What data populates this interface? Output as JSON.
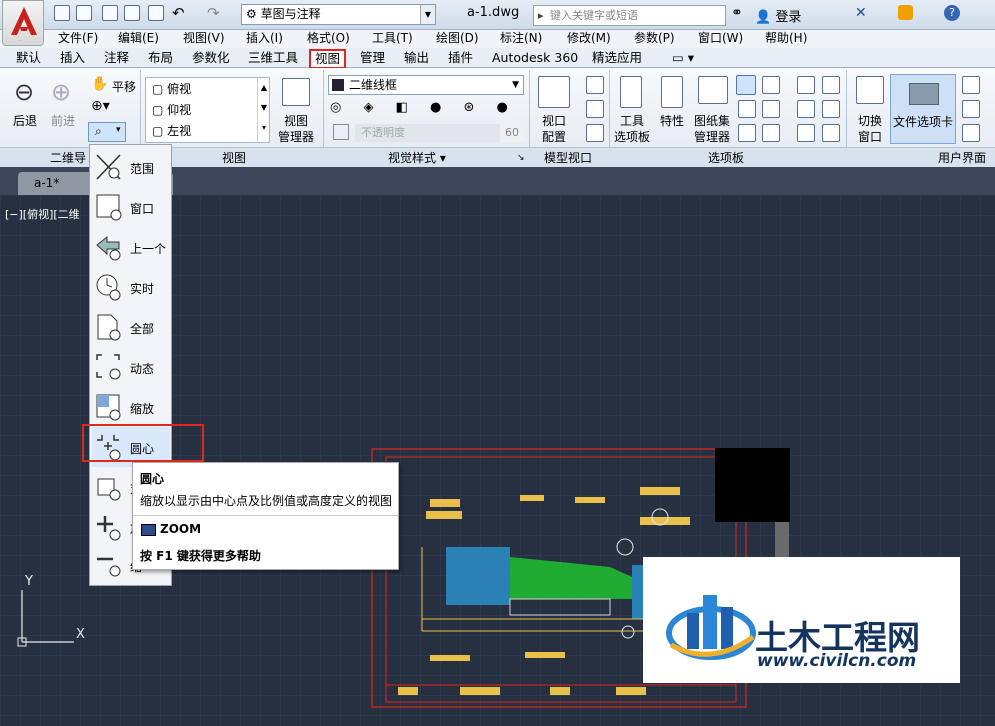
{
  "titlebar": {
    "workspace": "草图与注释",
    "document_title": "a-1.dwg",
    "search_placeholder": "键入关键字或短语",
    "login": "登录"
  },
  "menu": [
    "文件(F)",
    "编辑(E)",
    "视图(V)",
    "插入(I)",
    "格式(O)",
    "工具(T)",
    "绘图(D)",
    "标注(N)",
    "修改(M)",
    "参数(P)",
    "窗口(W)",
    "帮助(H)"
  ],
  "ribbon_tabs": [
    "默认",
    "插入",
    "注释",
    "布局",
    "参数化",
    "三维工具",
    "视图",
    "管理",
    "输出",
    "插件",
    "Autodesk 360",
    "精选应用"
  ],
  "ribbon": {
    "back": "后退",
    "forward": "前进",
    "pan": "平移",
    "views": [
      "俯视",
      "仰视",
      "左视"
    ],
    "view_manager_line1": "视图",
    "view_manager_line2": "管理器",
    "visual_style": "二维线框",
    "opacity_label": "不透明度",
    "opacity_value": "60",
    "viewport_line1": "视口",
    "viewport_line2": "配置",
    "tool_palettes_line1": "工具",
    "tool_palettes_line2": "选项板",
    "properties": "特性",
    "sheetset_line1": "图纸集",
    "sheetset_line2": "管理器",
    "switch_window_line1": "切换",
    "switch_window_line2": "窗口",
    "file_tabs": "文件选项卡"
  },
  "panels": {
    "nav2d": "二维导",
    "view": "视图",
    "visual_styles": "视觉样式",
    "model_viewports": "模型视口",
    "palettes": "选项板",
    "user_interface": "用户界面"
  },
  "doc_tab": "a-1*",
  "view_label": "[−][俯视][二维",
  "zoom_menu": [
    "范围",
    "窗口",
    "上一个",
    "实时",
    "全部",
    "动态",
    "缩放",
    "圆心",
    "对",
    "放",
    "缩"
  ],
  "tooltip": {
    "title": "圆心",
    "description": "缩放以显示由中心点及比例值或高度定义的视图",
    "command": "ZOOM",
    "help": "按 F1 键获得更多帮助"
  },
  "ucs": {
    "x": "X",
    "y": "Y"
  },
  "watermark": {
    "name": "土木工程网",
    "url": "www.civilcn.com"
  },
  "colors": {
    "accent_red": "#e0261d",
    "canvas": "#273040"
  }
}
